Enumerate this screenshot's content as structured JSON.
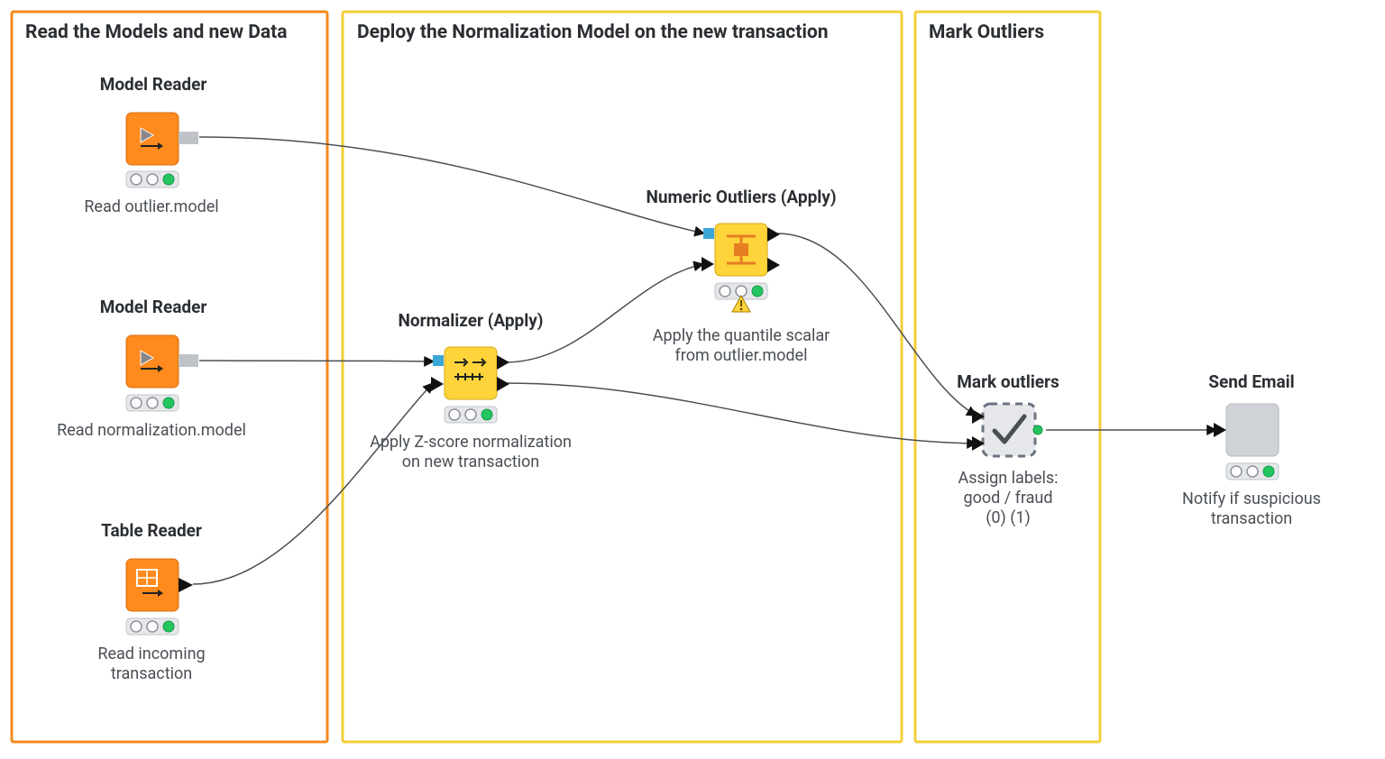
{
  "groups": {
    "read": {
      "title": "Read the Models and new Data"
    },
    "deploy": {
      "title": "Deploy the Normalization Model on the new transaction"
    },
    "mark": {
      "title": "Mark Outliers"
    }
  },
  "nodes": {
    "model_reader_1": {
      "title": "Model Reader",
      "desc": "Read outlier.model"
    },
    "model_reader_2": {
      "title": "Model Reader",
      "desc": "Read normalization.model"
    },
    "table_reader": {
      "title": "Table Reader",
      "desc_line1": "Read incoming",
      "desc_line2": "transaction"
    },
    "normalizer": {
      "title": "Normalizer (Apply)",
      "desc_line1": "Apply Z-score normalization",
      "desc_line2": "on new transaction"
    },
    "numeric_outliers": {
      "title": "Numeric Outliers (Apply)",
      "desc_line1": "Apply the quantile scalar",
      "desc_line2": "from outlier.model"
    },
    "mark_outliers": {
      "title": "Mark outliers",
      "desc_line1": "Assign labels:",
      "desc_line2": "good / fraud",
      "desc_line3": "(0)    (1)"
    },
    "send_email": {
      "title": "Send Email",
      "desc_line1": "Notify if suspicious",
      "desc_line2": "transaction"
    }
  }
}
